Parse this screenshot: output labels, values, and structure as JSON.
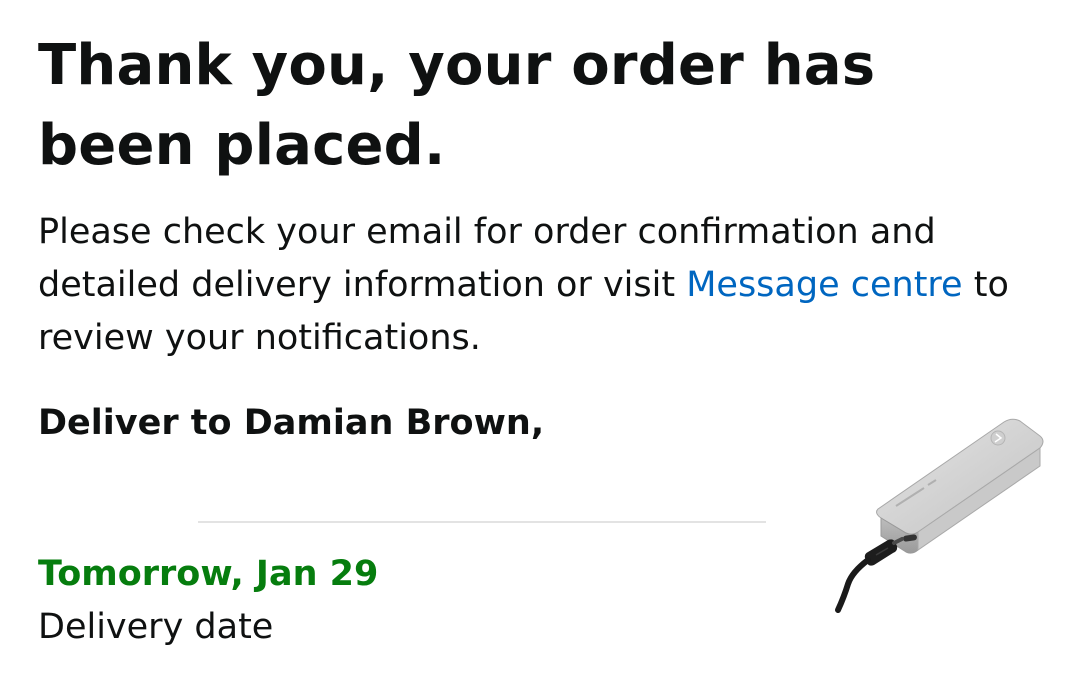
{
  "confirmation": {
    "heading": "Thank you, your order has been placed.",
    "message_before_link": "Please check your email for order confirmation and detailed delivery information or visit ",
    "message_link": "Message centre",
    "message_after_link": " to review your notifications."
  },
  "shipping": {
    "deliver_to": "Deliver to Damian Brown,"
  },
  "delivery": {
    "date": "Tomorrow, Jan 29",
    "date_caption": "Delivery date"
  },
  "product": {
    "image": "external-ssd-enclosure-with-usb-c-cable"
  },
  "colors": {
    "link": "#0066c0",
    "delivery_green": "#067d0e",
    "text": "#0f1111"
  }
}
